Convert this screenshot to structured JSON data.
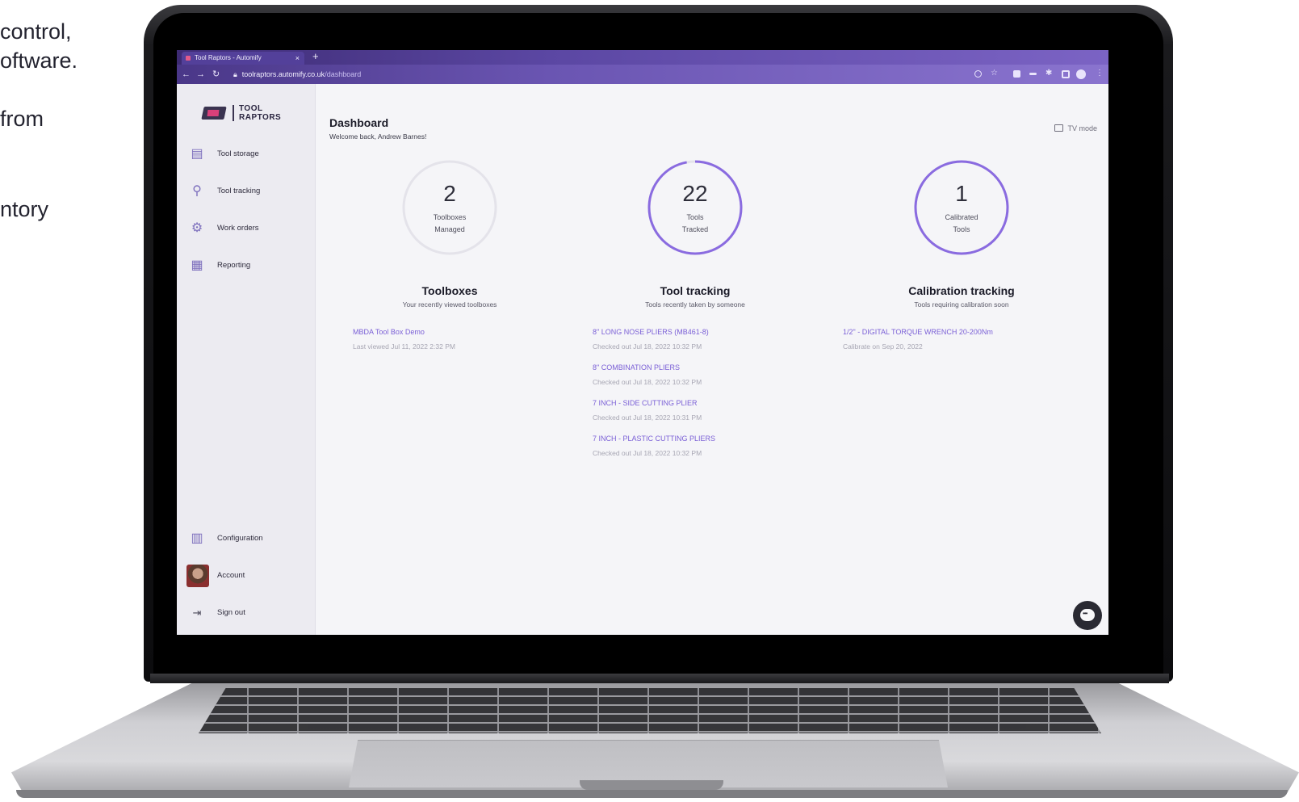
{
  "side_copy": {
    "line1": "control,",
    "line2": "oftware.",
    "line3": "from",
    "line4": "ntory"
  },
  "browser": {
    "tab_title": "Tool Raptors - Automify",
    "tab_close": "×",
    "new_tab": "+",
    "url_host": "toolraptors.automify.co.uk",
    "url_path": "/dashboard"
  },
  "logo": {
    "line1": "TOOL",
    "line2": "RAPTORS"
  },
  "sidebar": {
    "items": [
      {
        "label": "Tool storage",
        "icon": "tool-storage-icon"
      },
      {
        "label": "Tool tracking",
        "icon": "tool-tracking-icon"
      },
      {
        "label": "Work orders",
        "icon": "work-orders-icon"
      },
      {
        "label": "Reporting",
        "icon": "reporting-icon"
      }
    ],
    "bottom": [
      {
        "label": "Configuration",
        "icon": "configuration-icon"
      },
      {
        "label": "Account",
        "icon": "avatar"
      },
      {
        "label": "Sign out",
        "icon": "sign-out-icon"
      }
    ]
  },
  "header": {
    "title": "Dashboard",
    "welcome": "Welcome back, Andrew Barnes!",
    "tv_mode": "TV mode"
  },
  "cards": [
    {
      "count": "2",
      "count_label_1": "Toolboxes",
      "count_label_2": "Managed",
      "progress": 0,
      "title": "Toolboxes",
      "subtitle": "Your recently viewed toolboxes",
      "entries": [
        {
          "name": "MBDA Tool Box Demo",
          "meta": "Last viewed Jul 11, 2022 2:32 PM"
        }
      ]
    },
    {
      "count": "22",
      "count_label_1": "Tools",
      "count_label_2": "Tracked",
      "progress": 0.97,
      "title": "Tool tracking",
      "subtitle": "Tools recently taken by someone",
      "entries": [
        {
          "name": "8\" LONG NOSE PLIERS (MB461-8)",
          "meta": "Checked out Jul 18, 2022 10:32 PM"
        },
        {
          "name": "8\" COMBINATION PLIERS",
          "meta": "Checked out Jul 18, 2022 10:32 PM"
        },
        {
          "name": "7 INCH - SIDE CUTTING PLIER",
          "meta": "Checked out Jul 18, 2022 10:31 PM"
        },
        {
          "name": "7 INCH - PLASTIC CUTTING PLIERS",
          "meta": "Checked out Jul 18, 2022 10:32 PM"
        }
      ]
    },
    {
      "count": "1",
      "count_label_1": "Calibrated",
      "count_label_2": "Tools",
      "progress": 1,
      "title": "Calibration tracking",
      "subtitle": "Tools requiring calibration soon",
      "entries": [
        {
          "name": "1/2\" - DIGITAL TORQUE WRENCH 20-200Nm",
          "meta": "Calibrate on Sep 20, 2022"
        }
      ]
    }
  ],
  "colors": {
    "accent": "#8a6be0",
    "ring_track": "#e4e3ea",
    "browser": "#5b47a3"
  }
}
